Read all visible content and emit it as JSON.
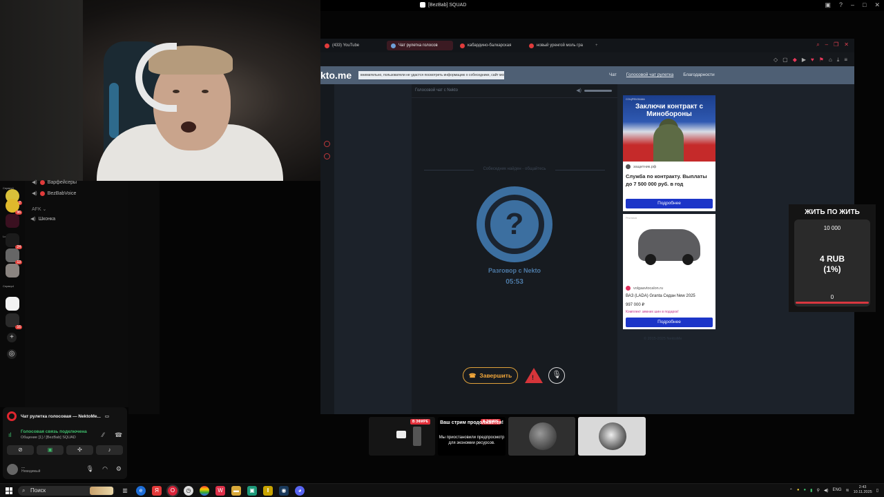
{
  "window": {
    "title": "[BezBab] SQUAD"
  },
  "discord": {
    "servers": [
      {
        "label": "Сервер1",
        "badge": "2"
      },
      {
        "label": "",
        "badge": "96"
      },
      {
        "label": "",
        "badge": ""
      },
      {
        "label": "Lounge",
        "badge": "24"
      },
      {
        "label": "",
        "badge": "13"
      },
      {
        "label": "",
        "badge": ""
      },
      {
        "label": "Сервер4",
        "badge": ""
      },
      {
        "label": "",
        "badge": ""
      },
      {
        "label": "",
        "badge": "16"
      }
    ],
    "channels": [
      {
        "name": "Варфейсеры",
        "kind": "user"
      },
      {
        "name": "BezBabVoice",
        "kind": "user"
      },
      {
        "name": "AFK ⌄",
        "kind": "voice"
      },
      {
        "name": "Шконка",
        "kind": "voice"
      }
    ],
    "voice_panel": {
      "activity": "Чат рулетка голосовая — NektoMe...",
      "connected": "Голосовая связь подключена",
      "channel": "Общение [1] / [BezBab] SQUAD",
      "username": "...",
      "status": "Невидимый"
    }
  },
  "browser": {
    "tabs": [
      {
        "label": "(433) YouTube",
        "active": false
      },
      {
        "label": "Чат рулетка голосов",
        "active": true
      },
      {
        "label": "кабардино-балкарская",
        "active": false
      },
      {
        "label": "новый уренгой моль гра",
        "active": false
      }
    ],
    "site": {
      "logo": "kto.me",
      "notice": "внимательно, пользователи не удастся посмотреть информацию о собеседнике, сайт можно спасать хорошие знакомых",
      "nav": [
        "Чат",
        "Голосовой чат рулетка",
        "Благодарности"
      ],
      "chat_title": "Голосовой чат с Nekto",
      "found_text": "Собеседник найден - общайтесь",
      "question_mark": "?",
      "talk_label": "Разговор с Nekto",
      "timer": "05:53",
      "end_button": "Завершить",
      "copyright": "© 2015-2025 NektoMe"
    },
    "ads": [
      {
        "tag": "СОЦРЕКЛАМА",
        "headline": "Заключи контракт с Минобороны",
        "source": "защитник.рф",
        "text": "Служба по контракту. Выплаты до 7 500 000 руб. в год",
        "button": "Подробнее"
      },
      {
        "tag": "Реклама",
        "source": "volgaavtocalon.ru",
        "title": "ВАЗ (LADA) Granta Седан New 2025",
        "price": "997 000 ₽",
        "promo": "Комплект зимних шин в подарок!",
        "button": "Подробнее"
      }
    ]
  },
  "donation": {
    "title": "ЖИТЬ ПО ЖИТЬ",
    "goal": "10 000",
    "current_line1": "4 RUB",
    "current_line2": "(1%)",
    "start": "0",
    "progress_percent": 1
  },
  "previews": {
    "live_badge": "В ЭФИРЕ",
    "paused_title": "Ваш стрим продолжается!",
    "paused_text": "Мы приостановили предпросмотр для экономии ресурсов."
  },
  "taskbar": {
    "search_placeholder": "Поиск",
    "lang": "ENG",
    "time": "2:43",
    "date": "10.11.2025"
  }
}
